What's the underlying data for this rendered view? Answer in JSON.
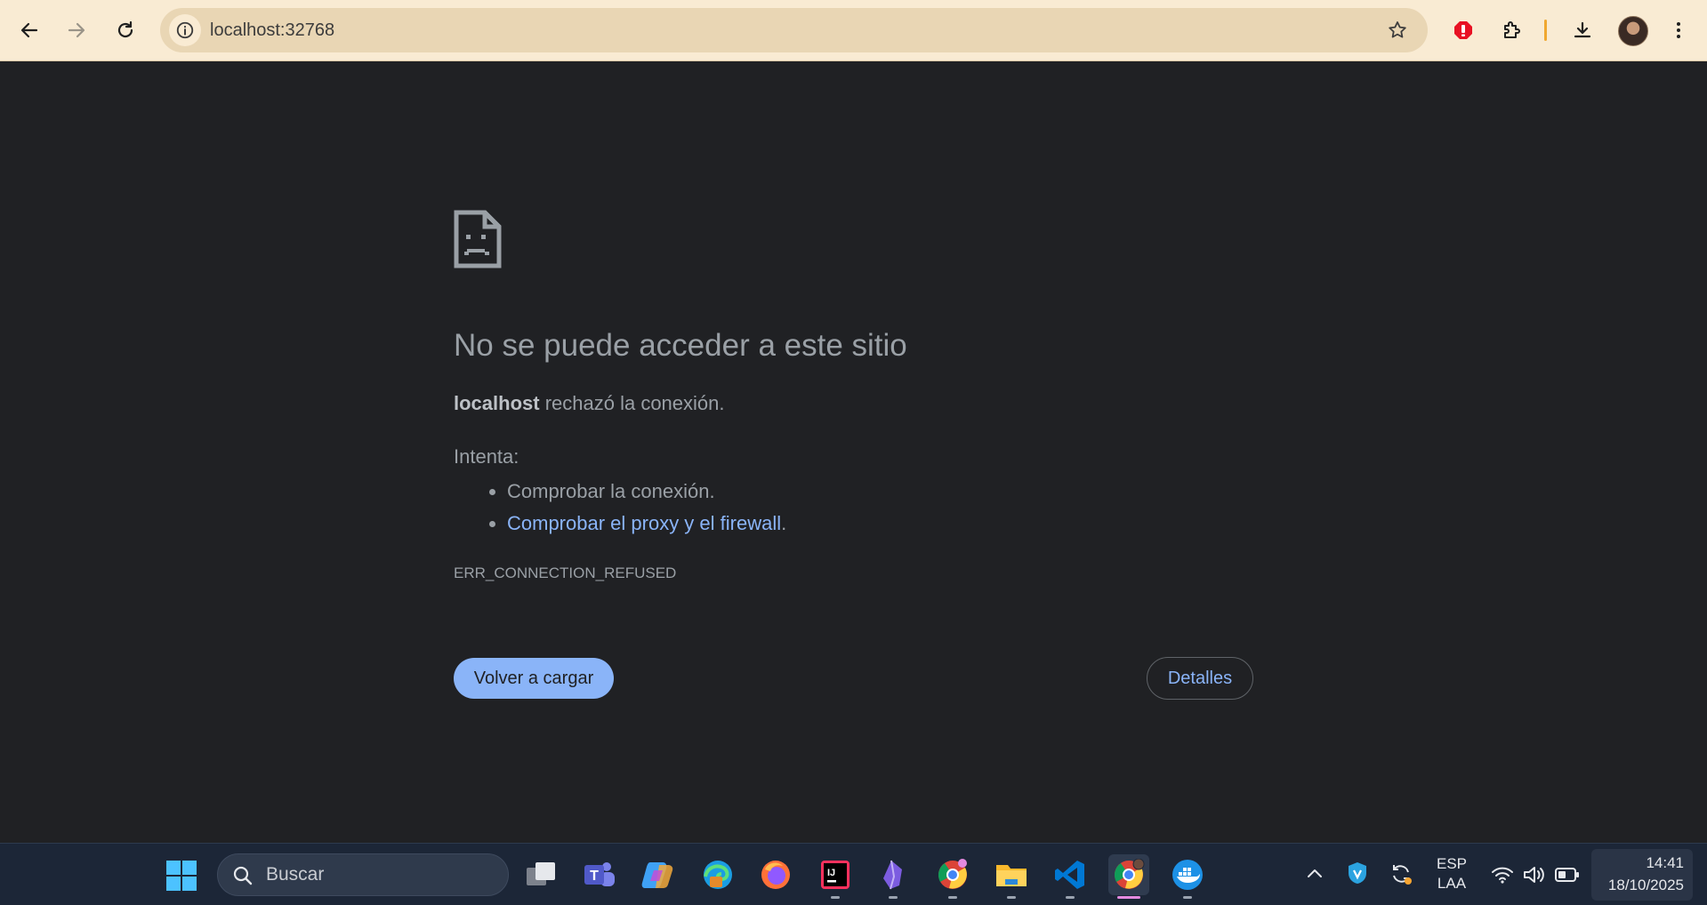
{
  "browser": {
    "url": "localhost:32768",
    "buttons": {
      "back": "back-arrow-icon",
      "forward": "forward-arrow-icon",
      "reload": "reload-icon",
      "info": "info-icon",
      "bookmark": "star-icon",
      "adblock": "adblock-icon",
      "extensions": "puzzle-icon",
      "downloads": "download-icon",
      "menu": "kebab-menu-icon"
    },
    "colors": {
      "toolbar": "#f9ebd3",
      "omnibox": "#e9d6b4",
      "adblock": "#e81123"
    }
  },
  "error_page": {
    "title": "No se puede acceder a este sitio",
    "host": "localhost",
    "host_message": "rechazó la conexión.",
    "try_label": "Intenta:",
    "suggestions": {
      "check_connection": "Comprobar la conexión.",
      "check_proxy_link": "Comprobar el proxy y el firewall",
      "check_proxy_suffix": "."
    },
    "error_code": "ERR_CONNECTION_REFUSED",
    "reload_button": "Volver a cargar",
    "details_button": "Detalles",
    "colors": {
      "background": "#202124",
      "text": "#9aa0a6",
      "link": "#8ab4f8",
      "button": "#8ab4f8"
    }
  },
  "taskbar": {
    "search_placeholder": "Buscar",
    "apps": [
      "task-view-icon",
      "teams-icon",
      "copilot-icon",
      "edge-icon",
      "firefox-icon",
      "intellij-icon",
      "obsidian-icon",
      "chrome-icon",
      "file-explorer-icon",
      "vscode-icon",
      "chrome-profile-icon",
      "docker-icon"
    ],
    "tray": {
      "language_line1": "ESP",
      "language_line2": "LAA",
      "time": "14:41",
      "date": "18/10/2025"
    }
  }
}
